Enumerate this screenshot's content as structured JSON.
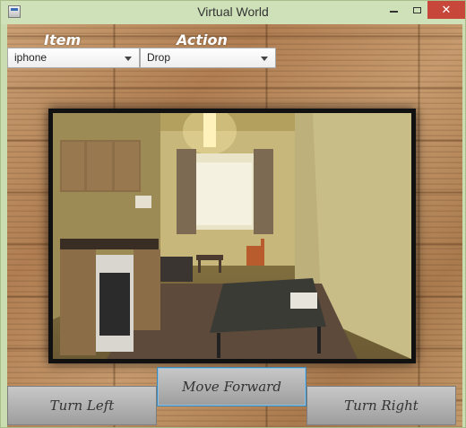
{
  "window": {
    "title": "Virtual World",
    "app_icon": "java-window-icon",
    "controls": {
      "minimize_icon": "minimize-icon",
      "maximize_icon": "maximize-icon",
      "close_icon": "close-icon",
      "close_glyph": "✕"
    }
  },
  "labels": {
    "item": "Item",
    "action": "Action"
  },
  "selectors": {
    "item": {
      "value": "iphone",
      "icon": "chevron-down-icon"
    },
    "action": {
      "value": "Drop",
      "icon": "chevron-down-icon"
    }
  },
  "scene": {
    "image": "room-photo"
  },
  "buttons": {
    "turn_left": "Turn Left",
    "move_forward": "Move Forward",
    "turn_right": "Turn Right"
  },
  "colors": {
    "titlebar": "#cfe1b8",
    "close_button": "#c7473b",
    "focused_button_border": "#3e86b3"
  }
}
